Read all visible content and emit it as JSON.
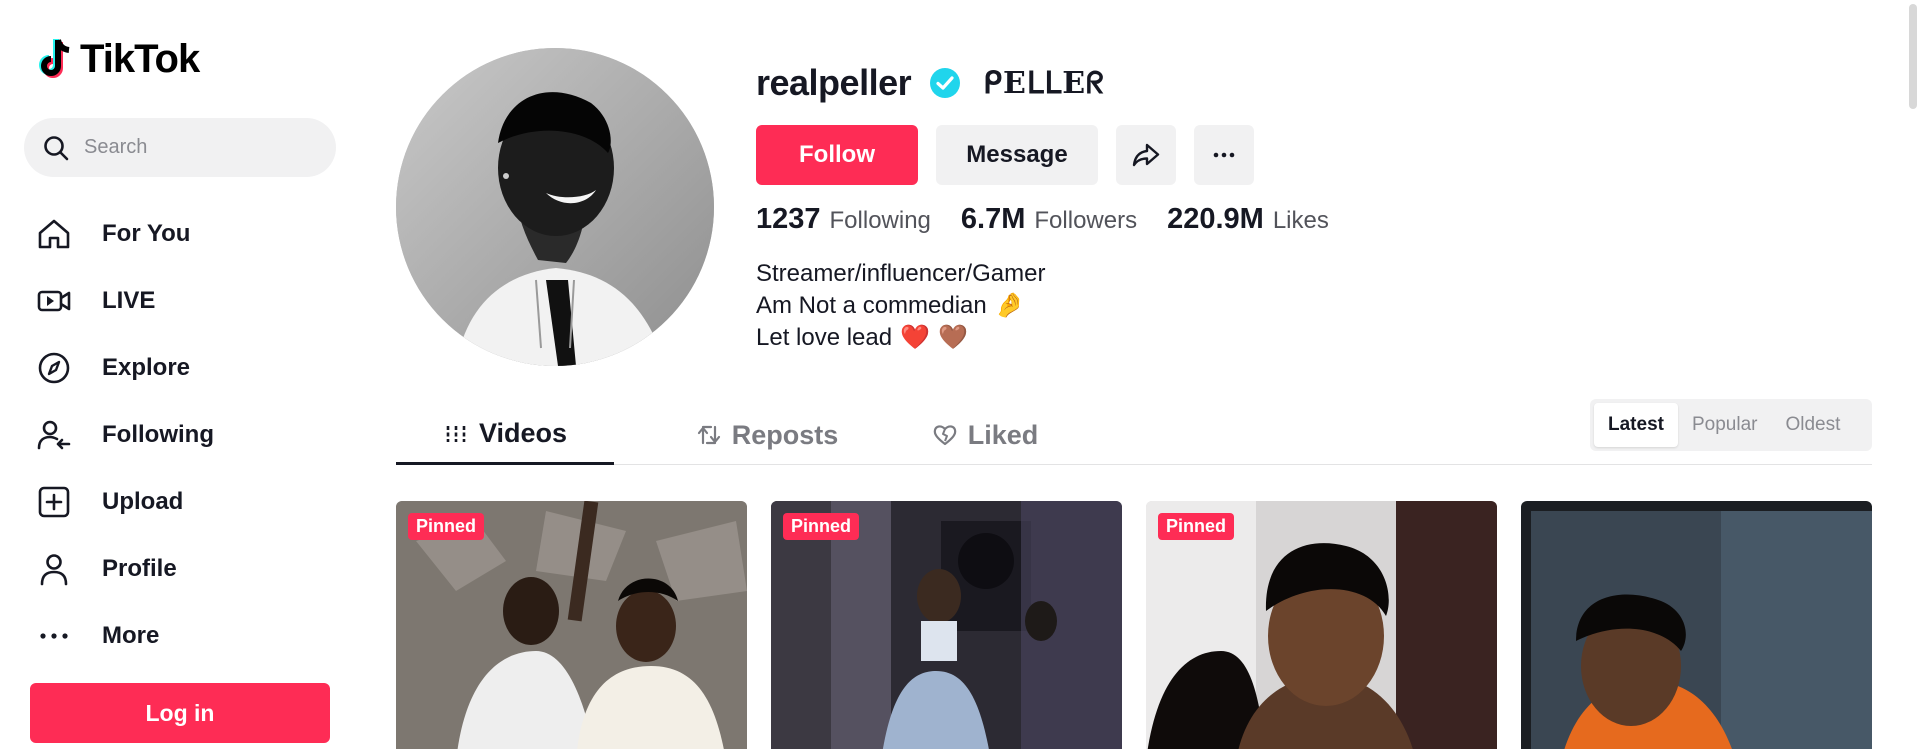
{
  "app": {
    "logo_text": "TikTok"
  },
  "search": {
    "placeholder": "Search"
  },
  "nav": {
    "items": [
      {
        "label": "For You",
        "icon": "home-icon"
      },
      {
        "label": "LIVE",
        "icon": "live-camera-icon"
      },
      {
        "label": "Explore",
        "icon": "compass-icon"
      },
      {
        "label": "Following",
        "icon": "user-following-icon"
      },
      {
        "label": "Upload",
        "icon": "plus-square-icon"
      },
      {
        "label": "Profile",
        "icon": "person-icon"
      },
      {
        "label": "More",
        "icon": "more-dots-icon"
      }
    ],
    "login_label": "Log in"
  },
  "profile": {
    "username": "realpeller",
    "verified": true,
    "nickname": "ᑭEᒪᒪEᖇ",
    "follow_label": "Follow",
    "message_label": "Message",
    "stats": {
      "following_count": "1237",
      "following_label": "Following",
      "followers_count": "6.7M",
      "followers_label": "Followers",
      "likes_count": "220.9M",
      "likes_label": "Likes"
    },
    "bio": {
      "line1": "Streamer/influencer/Gamer",
      "line2": "Am Not a commedian",
      "line2_emoji": "🤌",
      "line3": "Let love lead",
      "line3_emoji1": "❤️",
      "line3_emoji2": "🤎"
    }
  },
  "tabs": {
    "videos": "Videos",
    "reposts": "Reposts",
    "liked": "Liked",
    "active": "Videos"
  },
  "sort": {
    "options": [
      "Latest",
      "Popular",
      "Oldest"
    ],
    "active": "Latest"
  },
  "videos": [
    {
      "badge": "Pinned"
    },
    {
      "badge": "Pinned"
    },
    {
      "badge": "Pinned"
    },
    {
      "badge": ""
    }
  ],
  "colors": {
    "accent": "#fe2c55",
    "verified": "#20d5ec",
    "text": "#161823",
    "muted": "#52535a",
    "surface": "#f1f1f2"
  }
}
